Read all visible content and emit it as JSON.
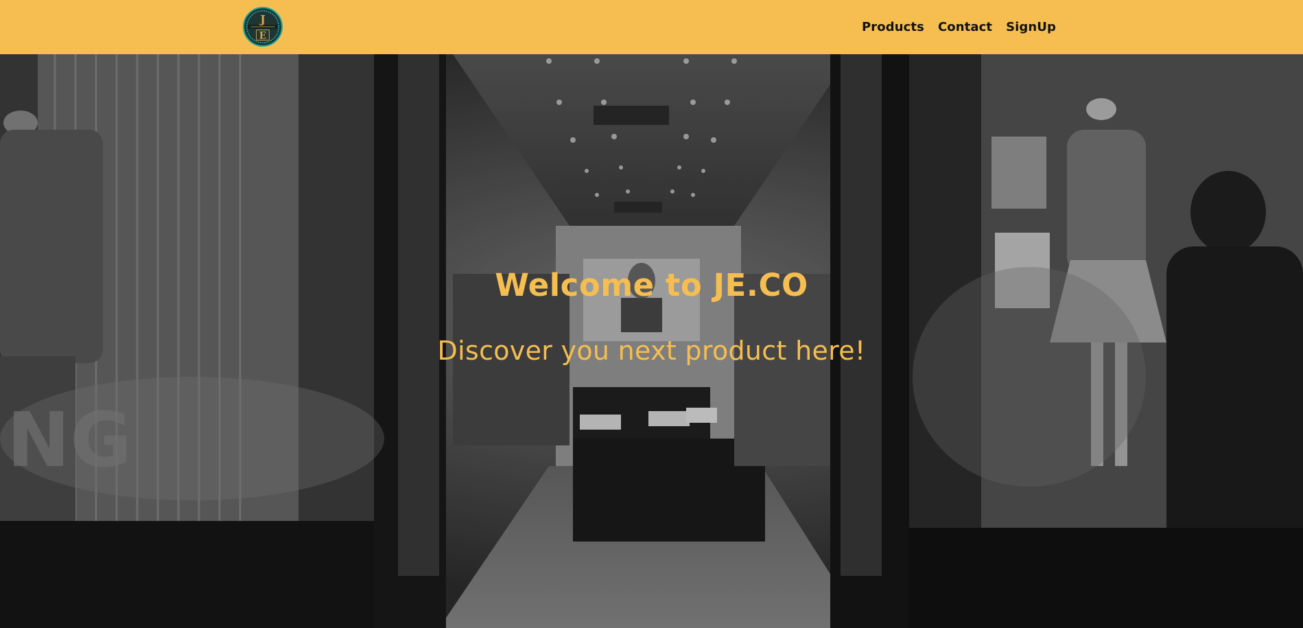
{
  "brand": {
    "logo_icon": "jeco-logo-badge",
    "accent_color": "#F6BE50"
  },
  "nav": {
    "links": [
      {
        "label": "Products"
      },
      {
        "label": "Contact"
      },
      {
        "label": "SignUp"
      }
    ]
  },
  "hero": {
    "title": "Welcome to JE.CO",
    "subtitle": "Discover you next product here!",
    "background": "grayscale clothing store entrance photo"
  }
}
